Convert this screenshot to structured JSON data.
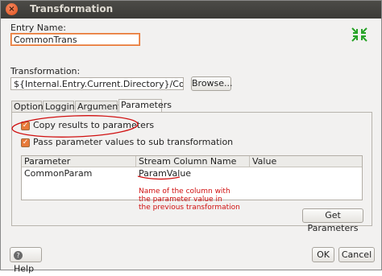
{
  "window": {
    "title": "Transformation",
    "close_icon": "close-icon"
  },
  "entry_name": {
    "label": "Entry Name:",
    "value": "CommonTrans"
  },
  "transformation": {
    "label": "Transformation:",
    "value": "${Internal.Entry.Current.Directory}/CommonTrans",
    "browse_label": "Browse..."
  },
  "tabs": [
    {
      "label": "Options"
    },
    {
      "label": "Logging"
    },
    {
      "label": "Arguments"
    },
    {
      "label": "Parameters"
    }
  ],
  "parameters": {
    "copy_results_label": "Copy results to parameters",
    "copy_results_checked": true,
    "pass_values_label": "Pass parameter values to sub transformation",
    "pass_values_checked": true,
    "columns": [
      "Parameter",
      "Stream Column Name",
      "Value"
    ],
    "rows": [
      {
        "parameter": "CommonParam",
        "stream_column": "ParamValue",
        "value": ""
      }
    ],
    "get_parameters_label": "Get Parameters",
    "annotation_lines": [
      "Name of the column with",
      "the parameter value in",
      "the previous transformation"
    ]
  },
  "footer": {
    "help_label": "Help",
    "ok_label": "OK",
    "cancel_label": "Cancel"
  },
  "colors": {
    "accent": "#e8742f",
    "annotation": "#d01010",
    "titlebar": "#3c3b37",
    "resize_icon": "#27a327"
  }
}
